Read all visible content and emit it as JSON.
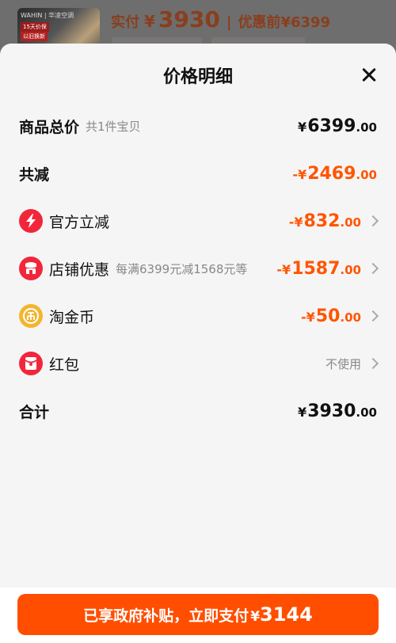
{
  "background": {
    "thumb_brand": "WAHIN | 华凌空调",
    "thumb_tag": "15天价保",
    "thumb_tag2": "以旧换新",
    "paid_label": "实付",
    "currency": "¥",
    "paid_amount": "3930",
    "separator": "|",
    "pre_label": "优惠前",
    "pre_amount": "¥6399"
  },
  "sheet": {
    "title": "价格明细",
    "rows": [
      {
        "label": "商品总价",
        "sub": "共1件宝贝",
        "sym": "¥",
        "int": "6399",
        "dec": ".00"
      },
      {
        "label": "共减",
        "sym": "-¥",
        "int": "2469",
        "dec": ".00"
      },
      {
        "label": "官方立减",
        "icon": "lightning-icon",
        "sym": "-¥",
        "int": "832",
        "dec": ".00"
      },
      {
        "label": "店铺优惠",
        "icon": "store-icon",
        "sub": "每满6399元减1568元等",
        "sym": "-¥",
        "int": "1587",
        "dec": ".00"
      },
      {
        "label": "淘金币",
        "icon": "coin-icon",
        "sym": "-¥",
        "int": "50",
        "dec": ".00"
      },
      {
        "label": "红包",
        "icon": "red-packet-icon",
        "value": "不使用"
      },
      {
        "label": "合计",
        "sym": "¥",
        "int": "3930",
        "dec": ".00"
      }
    ]
  },
  "footer": {
    "pay_text": "已享政府补贴，立即支付",
    "pay_sym": "¥",
    "pay_amount": "3144"
  },
  "colors": {
    "accent": "#ff5500",
    "button": "#ff4e00",
    "icon_red": "#f2263b",
    "icon_gold": "#f3b52d"
  }
}
